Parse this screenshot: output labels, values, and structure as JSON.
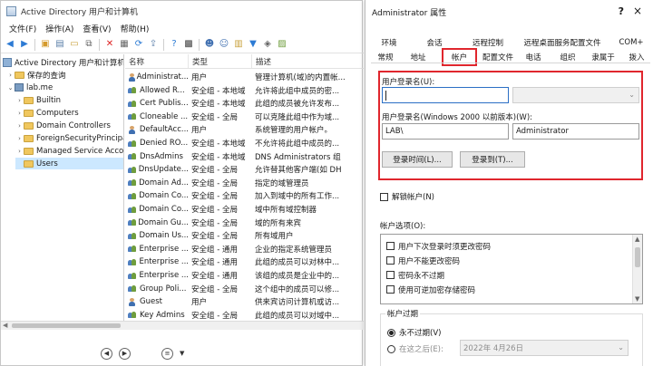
{
  "main": {
    "title": "Active Directory 用户和计算机",
    "menu": [
      "文件(F)",
      "操作(A)",
      "查看(V)",
      "帮助(H)"
    ],
    "tree": [
      {
        "label": "Active Directory 用户和计算机",
        "kind": "root",
        "depth": 0,
        "twisty": ""
      },
      {
        "label": "保存的查询",
        "kind": "folder",
        "depth": 1,
        "twisty": "›"
      },
      {
        "label": "lab.me",
        "kind": "domain",
        "depth": 1,
        "twisty": "⌄"
      },
      {
        "label": "Builtin",
        "kind": "folder",
        "depth": 2,
        "twisty": "›"
      },
      {
        "label": "Computers",
        "kind": "folder",
        "depth": 2,
        "twisty": "›"
      },
      {
        "label": "Domain Controllers",
        "kind": "folder",
        "depth": 2,
        "twisty": "›"
      },
      {
        "label": "ForeignSecurityPrincipa",
        "kind": "folder",
        "depth": 2,
        "twisty": "›"
      },
      {
        "label": "Managed Service Acco",
        "kind": "folder",
        "depth": 2,
        "twisty": "›"
      },
      {
        "label": "Users",
        "kind": "folder",
        "depth": 2,
        "twisty": "",
        "selected": true
      }
    ],
    "columns": {
      "name": "名称",
      "type": "类型",
      "desc": "描述"
    },
    "rows": [
      {
        "name": "Administrat...",
        "type": "用户",
        "desc": "管理计算机(域)的内置帐...",
        "icon": "user"
      },
      {
        "name": "Allowed R...",
        "type": "安全组 - 本地域",
        "desc": "允许将此组中成员的密...",
        "icon": "group"
      },
      {
        "name": "Cert Publis...",
        "type": "安全组 - 本地域",
        "desc": "此组的成员被允许发布...",
        "icon": "group"
      },
      {
        "name": "Cloneable ...",
        "type": "安全组 - 全局",
        "desc": "可以克隆此组中作为域...",
        "icon": "group"
      },
      {
        "name": "DefaultAcc...",
        "type": "用户",
        "desc": "系统管理的用户帐户。",
        "icon": "user"
      },
      {
        "name": "Denied RO...",
        "type": "安全组 - 本地域",
        "desc": "不允许将此组中成员的...",
        "icon": "group"
      },
      {
        "name": "DnsAdmins",
        "type": "安全组 - 本地域",
        "desc": "DNS Administrators 组",
        "icon": "group"
      },
      {
        "name": "DnsUpdate...",
        "type": "安全组 - 全局",
        "desc": "允许替其他客户端(如 DH",
        "icon": "group"
      },
      {
        "name": "Domain Ad...",
        "type": "安全组 - 全局",
        "desc": "指定的域管理员",
        "icon": "group"
      },
      {
        "name": "Domain Co...",
        "type": "安全组 - 全局",
        "desc": "加入到域中的所有工作...",
        "icon": "group"
      },
      {
        "name": "Domain Co...",
        "type": "安全组 - 全局",
        "desc": "域中所有域控制器",
        "icon": "group"
      },
      {
        "name": "Domain Gu...",
        "type": "安全组 - 全局",
        "desc": "域的所有来宾",
        "icon": "group"
      },
      {
        "name": "Domain Us...",
        "type": "安全组 - 全局",
        "desc": "所有域用户",
        "icon": "group"
      },
      {
        "name": "Enterprise ...",
        "type": "安全组 - 通用",
        "desc": "企业的指定系统管理员",
        "icon": "group"
      },
      {
        "name": "Enterprise ...",
        "type": "安全组 - 通用",
        "desc": "此组的成员可以对林中...",
        "icon": "group"
      },
      {
        "name": "Enterprise ...",
        "type": "安全组 - 通用",
        "desc": "该组的成员是企业中的...",
        "icon": "group"
      },
      {
        "name": "Group Poli...",
        "type": "安全组 - 全局",
        "desc": "这个组中的成员可以修...",
        "icon": "group"
      },
      {
        "name": "Guest",
        "type": "用户",
        "desc": "供来宾访问计算机或访...",
        "icon": "user"
      },
      {
        "name": "Key Admins",
        "type": "安全组 - 全局",
        "desc": "此组的成员可以对域中...",
        "icon": "group"
      }
    ]
  },
  "dialog": {
    "title": "Administrator 属性",
    "help": "?",
    "close": "×",
    "tabs_row1": [
      "环境",
      "会话",
      "远程控制",
      "远程桌面服务配置文件",
      "COM+"
    ],
    "tabs_row2": [
      "常规",
      "地址",
      "帐户",
      "配置文件",
      "电话",
      "组织",
      "隶属于",
      "拨入"
    ],
    "active_tab": "帐户",
    "logon_name_label": "用户登录名(U):",
    "logon_name_value": "",
    "logon_pre2000_label": "用户登录名(Windows 2000 以前版本)(W):",
    "domain_prefix": "LAB\\",
    "pre2000_value": "Administrator",
    "logon_hours_button": "登录时间(L)...",
    "logon_to_button": "登录到(T)...",
    "unlock_label": "解锁帐户(N)",
    "options_label": "帐户选项(O):",
    "options": [
      "用户下次登录时须更改密码",
      "用户不能更改密码",
      "密码永不过期",
      "使用可逆加密存储密码"
    ],
    "options_checked": [
      false,
      false,
      false,
      false
    ],
    "expiry_label": "帐户过期",
    "never_label": "永不过期(V)",
    "end_of_label": "在这之后(E):",
    "end_of_date": "2022年  4月26日"
  }
}
